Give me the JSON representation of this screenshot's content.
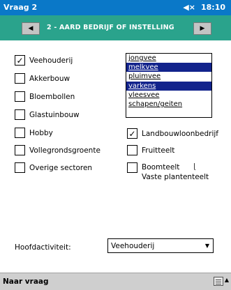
{
  "titlebar": {
    "app_title": "Vraag 2",
    "time": "18:10",
    "speaker_icon": "speaker-icon"
  },
  "navbar": {
    "title": "2 - AARD BEDRIJF OF INSTELLING",
    "prev_icon": "arrow-left-icon",
    "next_icon": "arrow-right-icon"
  },
  "checkboxes_left": [
    {
      "label": "Veehouderij",
      "checked": true
    },
    {
      "label": "Akkerbouw",
      "checked": false
    },
    {
      "label": "Bloembollen",
      "checked": false
    },
    {
      "label": "Glastuinbouw",
      "checked": false
    },
    {
      "label": "Hobby",
      "checked": false
    },
    {
      "label": "Vollegrondsgroente",
      "checked": false
    },
    {
      "label": "Overige sectoren",
      "checked": false
    }
  ],
  "listbox": {
    "options": [
      {
        "label": "jongvee",
        "selected": false
      },
      {
        "label": "melkvee",
        "selected": true
      },
      {
        "label": "pluimvee",
        "selected": false
      },
      {
        "label": "varkens",
        "selected": true
      },
      {
        "label": "vleesvee",
        "selected": false
      },
      {
        "label": "schapen/geiten",
        "selected": false
      }
    ],
    "selected_color": "#12238c"
  },
  "checkboxes_right": [
    {
      "label": "Landbouwloonbedrijf",
      "checked": true
    },
    {
      "label": "Fruitteelt",
      "checked": false
    },
    {
      "label": "Boomteelt",
      "label2": "Vaste plantenteelt",
      "checked": false
    }
  ],
  "hoofdactiviteit": {
    "label": "Hoofdactiviteit:",
    "value": "Veehouderij"
  },
  "bottombar": {
    "menu_label": "Naar vraag",
    "keyboard_icon": "keyboard-icon"
  },
  "colors": {
    "titlebar": "#0a78c8",
    "navbar": "#2aa38c",
    "bottombar": "#cfcfcf"
  }
}
